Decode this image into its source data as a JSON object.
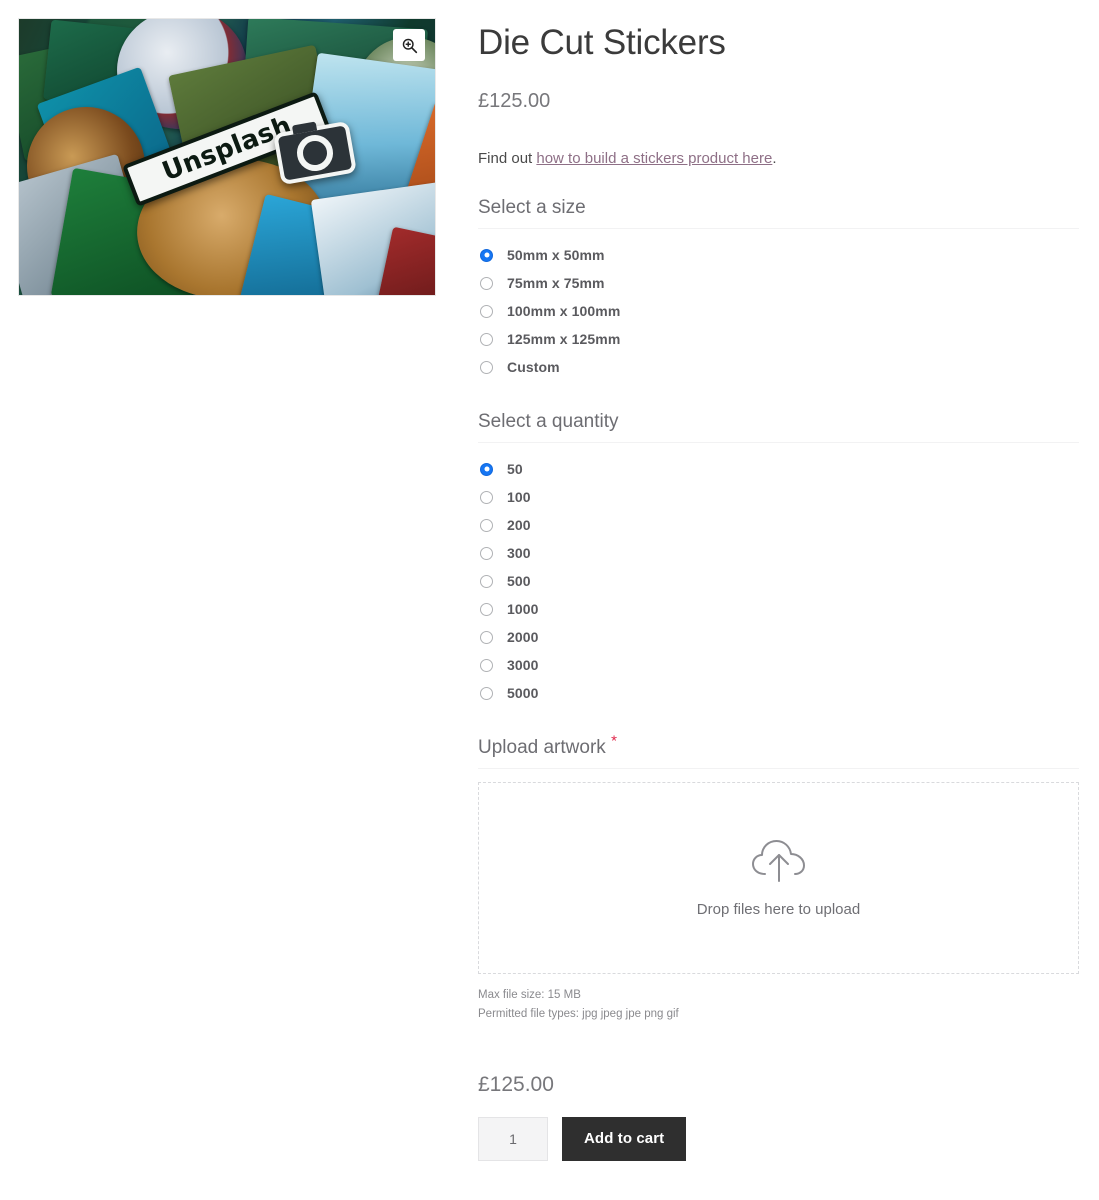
{
  "gallery": {
    "zoom_icon": "magnifier-plus-icon",
    "image_alt": "Pile of embroidered patches and die cut stickers",
    "sticker_wordmark": "Unsplash",
    "camera_logo": "camera-icon"
  },
  "product": {
    "title": "Die Cut Stickers",
    "price_top": "£125.00",
    "price_bottom": "£125.00",
    "help_prefix": "Find out ",
    "help_link": "how to build a stickers product here",
    "help_suffix": "."
  },
  "size_field": {
    "heading": "Select a size",
    "options": [
      {
        "label": "50mm x 50mm",
        "checked": true
      },
      {
        "label": "75mm x 75mm",
        "checked": false
      },
      {
        "label": "100mm x 100mm",
        "checked": false
      },
      {
        "label": "125mm x 125mm",
        "checked": false
      },
      {
        "label": "Custom",
        "checked": false
      }
    ]
  },
  "quantity_field": {
    "heading": "Select a quantity",
    "options": [
      {
        "label": "50",
        "checked": true
      },
      {
        "label": "100",
        "checked": false
      },
      {
        "label": "200",
        "checked": false
      },
      {
        "label": "300",
        "checked": false
      },
      {
        "label": "500",
        "checked": false
      },
      {
        "label": "1000",
        "checked": false
      },
      {
        "label": "2000",
        "checked": false
      },
      {
        "label": "3000",
        "checked": false
      },
      {
        "label": "5000",
        "checked": false
      }
    ]
  },
  "upload_field": {
    "heading": "Upload artwork",
    "required_marker": "*",
    "dropzone_icon": "cloud-upload-icon",
    "dropzone_text": "Drop files here to upload",
    "max_size_note": "Max file size: 15 MB",
    "permitted_types_note": "Permitted file types: jpg jpeg jpe png gif"
  },
  "cart": {
    "quantity_value": "1",
    "quantity_placeholder": "1",
    "add_to_cart_label": "Add to cart"
  },
  "colors": {
    "accent_radio": "#1676f3",
    "required_asterisk": "#e0264a",
    "link": "#8e6f86",
    "button_bg": "#2f2f2f",
    "heading_text": "#6d6d72"
  }
}
